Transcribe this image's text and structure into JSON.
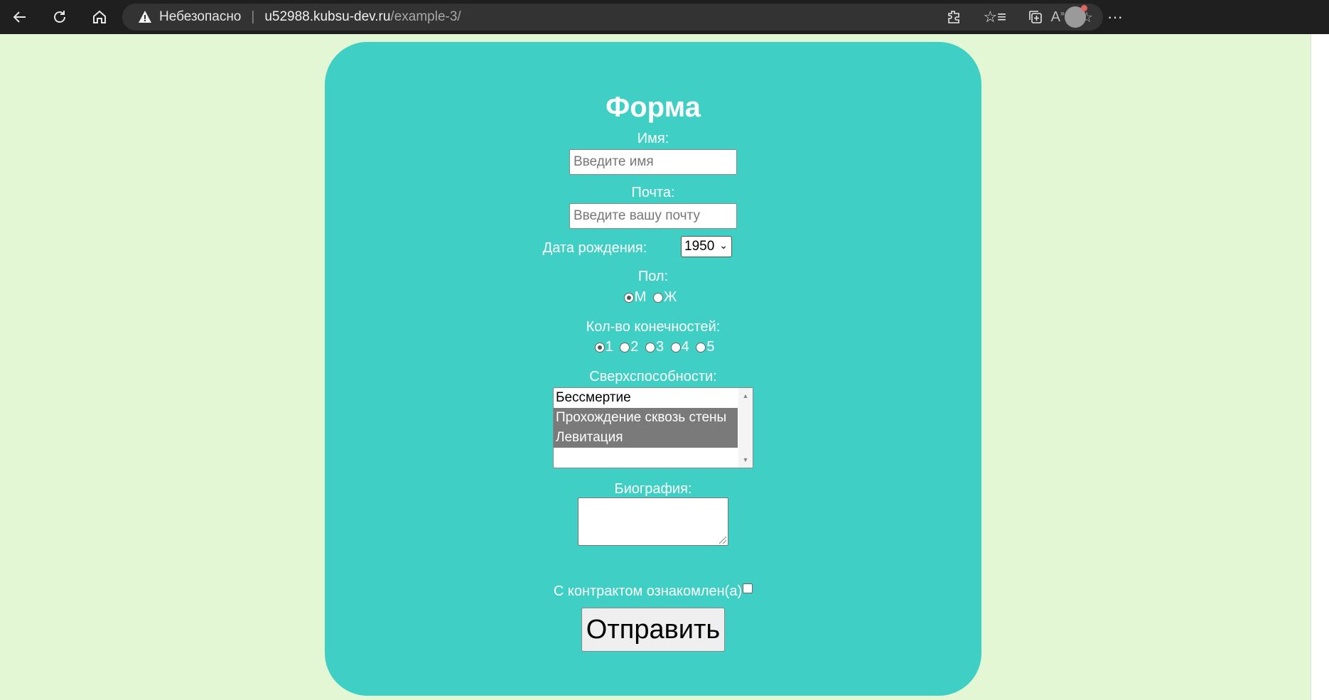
{
  "browser": {
    "security_label": "Небезопасно",
    "url_host": "u52988.kubsu-dev.ru",
    "url_path": "/example-3/"
  },
  "form": {
    "title": "Форма",
    "name_label": "Имя:",
    "name_placeholder": "Введите имя",
    "email_label": "Почта:",
    "email_placeholder": "Введите вашу почту",
    "birthdate_label": "Дата рождения:",
    "birthdate_value": "1950",
    "gender_label": "Пол:",
    "gender_options": [
      "М",
      "Ж"
    ],
    "gender_selected": "М",
    "limbs_label": "Кол-во конечностей:",
    "limbs_options": [
      "1",
      "2",
      "3",
      "4",
      "5"
    ],
    "limbs_selected": "1",
    "abilities_label": "Сверхспособности:",
    "abilities_options": [
      {
        "label": "Бессмертие",
        "selected": false
      },
      {
        "label": "Прохождение сквозь стены",
        "selected": true
      },
      {
        "label": "Левитация",
        "selected": true
      }
    ],
    "bio_label": "Биография:",
    "contract_label": "С контрактом ознакомлен(а)",
    "contract_checked": false,
    "submit_label": "Отправить"
  }
}
